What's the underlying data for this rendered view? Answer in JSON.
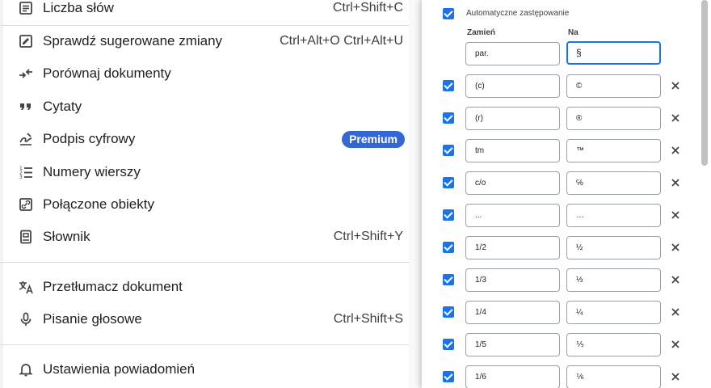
{
  "menu": {
    "items": [
      {
        "label": "Liczba słów",
        "shortcut": "Ctrl+Shift+C",
        "icon": "word-count-icon"
      },
      {
        "label": "Sprawdź sugerowane zmiany",
        "shortcut": "Ctrl+Alt+O Ctrl+Alt+U",
        "icon": "review-edits-icon"
      },
      {
        "label": "Porównaj dokumenty",
        "shortcut": "",
        "icon": "compare-icon"
      },
      {
        "label": "Cytaty",
        "shortcut": "",
        "icon": "quote-icon"
      },
      {
        "label": "Podpis cyfrowy",
        "badge": "Premium",
        "icon": "signature-icon"
      },
      {
        "label": "Numery wierszy",
        "shortcut": "",
        "icon": "line-numbers-icon"
      },
      {
        "label": "Połączone obiekty",
        "shortcut": "",
        "icon": "linked-objects-icon"
      },
      {
        "label": "Słownik",
        "shortcut": "Ctrl+Shift+Y",
        "icon": "dictionary-icon"
      },
      {
        "label": "Przetłumacz dokument",
        "shortcut": "",
        "icon": "translate-icon"
      },
      {
        "label": "Pisanie głosowe",
        "shortcut": "Ctrl+Shift+S",
        "icon": "microphone-icon"
      },
      {
        "label": "Ustawienia powiadomień",
        "shortcut": "",
        "icon": "bell-icon"
      }
    ]
  },
  "substitutions": {
    "auto_label": "Automatyczne zastępowanie",
    "col_replace": "Zamień",
    "col_with": "Na",
    "new_row": {
      "replace": "par.",
      "with": "§"
    },
    "rows": [
      {
        "replace": "(c)",
        "with": "©"
      },
      {
        "replace": "(r)",
        "with": "®"
      },
      {
        "replace": "tm",
        "with": "™"
      },
      {
        "replace": "c/o",
        "with": "℅"
      },
      {
        "replace": "...",
        "with": "…"
      },
      {
        "replace": "1/2",
        "with": "½"
      },
      {
        "replace": "1/3",
        "with": "⅓"
      },
      {
        "replace": "1/4",
        "with": "¼"
      },
      {
        "replace": "1/5",
        "with": "⅕"
      },
      {
        "replace": "1/6",
        "with": "⅙"
      }
    ]
  },
  "colors": {
    "accent": "#1a73e8",
    "badge": "#3367d6",
    "separator": "#dadce0"
  }
}
